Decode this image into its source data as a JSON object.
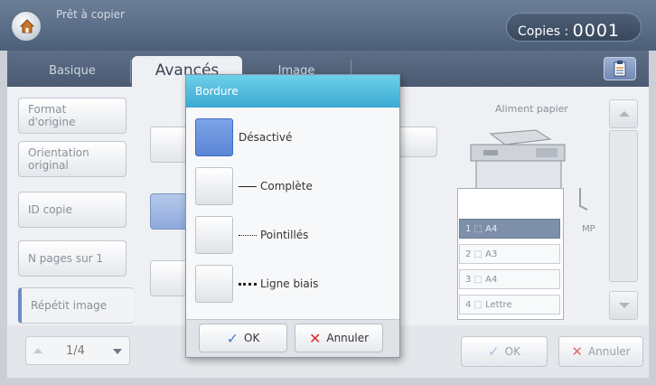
{
  "header": {
    "status": "Prêt à copier",
    "copies_label": "Copies :",
    "copies_value": "0001"
  },
  "tabs": [
    {
      "label": "Basique"
    },
    {
      "label": "Avancés"
    },
    {
      "label": "Image"
    }
  ],
  "left_menu": [
    {
      "label": "Format d'origine"
    },
    {
      "label": "Orientation original"
    },
    {
      "label": "ID copie"
    },
    {
      "label": "N pages sur 1"
    },
    {
      "label": "Répétit image"
    }
  ],
  "paper": {
    "title": "Aliment papier",
    "trays": [
      {
        "label": "1 ⬚ A4"
      },
      {
        "label": "2 ⬚ A3"
      },
      {
        "label": "3 ⬚ A4"
      },
      {
        "label": "4 ⬚ Lettre"
      }
    ],
    "mp_label": "MP"
  },
  "pager": {
    "text": "1/4"
  },
  "bottom": {
    "ok": "OK",
    "cancel": "Annuler"
  },
  "dialog": {
    "title": "Bordure",
    "options": [
      {
        "label": "Désactivé",
        "selected": true
      },
      {
        "label": "Complète",
        "selected": false
      },
      {
        "label": "Pointillés",
        "selected": false
      },
      {
        "label": "Ligne biais",
        "selected": false
      }
    ],
    "ok": "OK",
    "cancel": "Annuler"
  }
}
